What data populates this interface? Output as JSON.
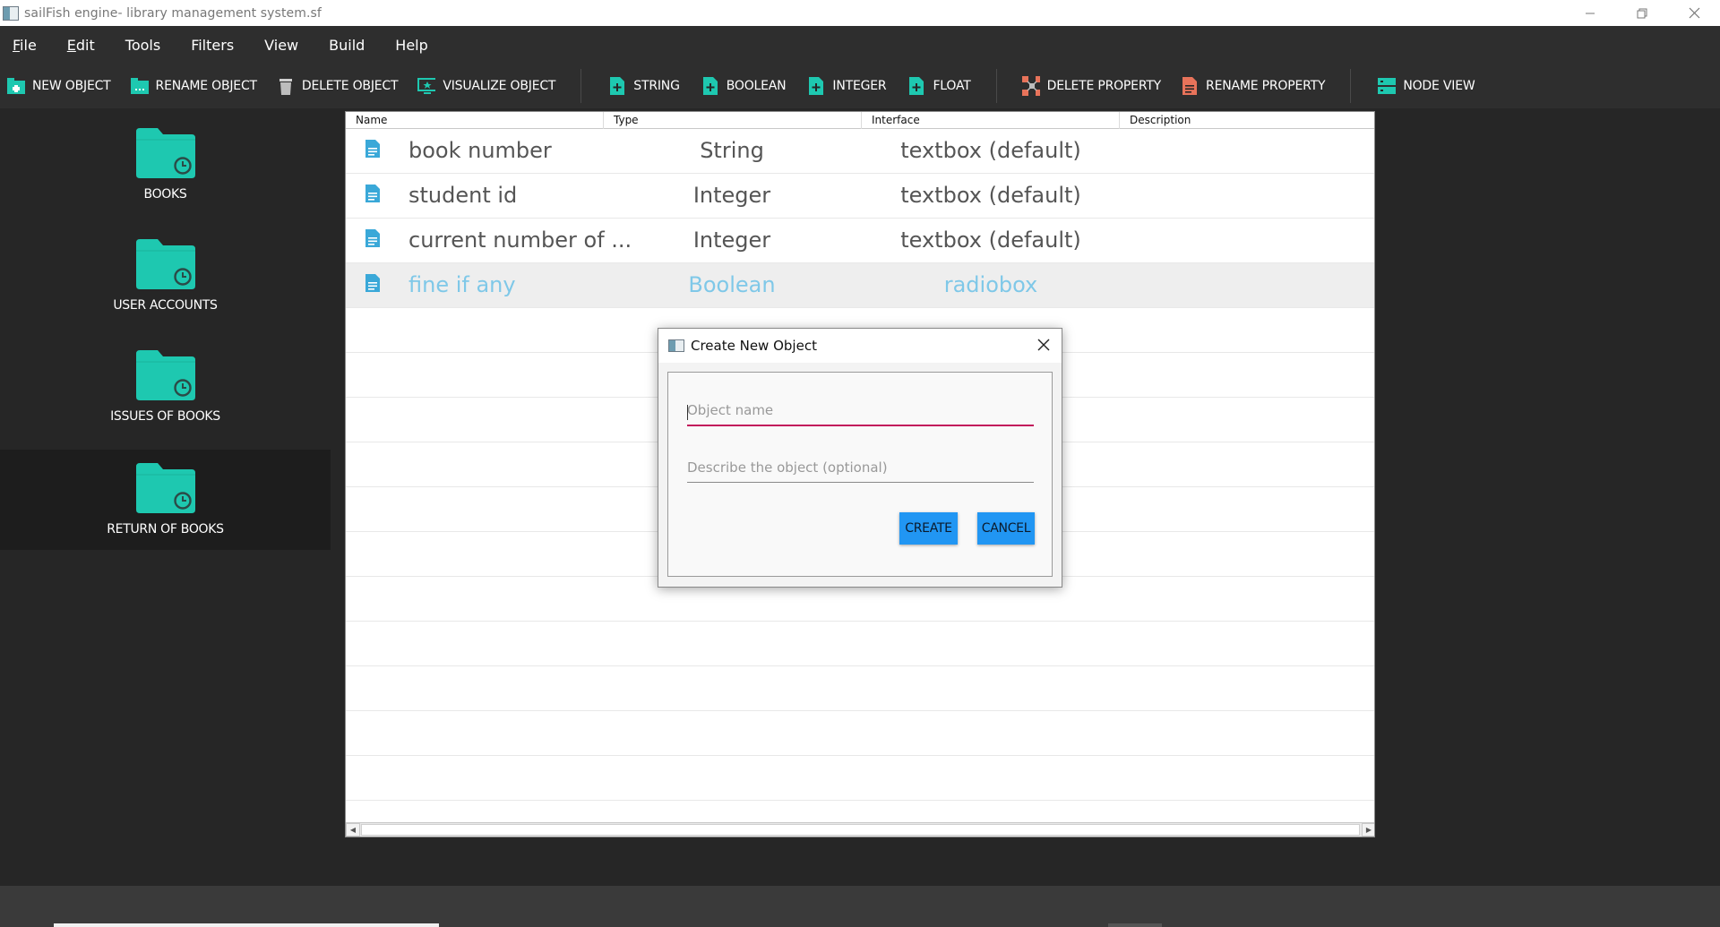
{
  "window": {
    "title": "sailFish engine- library management system.sf",
    "controls": [
      "minimize",
      "restore",
      "close"
    ]
  },
  "menu": [
    {
      "pre": "",
      "mnemonic": "F",
      "post": "ile"
    },
    {
      "pre": "",
      "mnemonic": "E",
      "post": "dit"
    },
    {
      "pre": "Tools",
      "mnemonic": "",
      "post": ""
    },
    {
      "pre": "Filters",
      "mnemonic": "",
      "post": ""
    },
    {
      "pre": "View",
      "mnemonic": "",
      "post": ""
    },
    {
      "pre": "Build",
      "mnemonic": "",
      "post": ""
    },
    {
      "pre": "Help",
      "mnemonic": "",
      "post": ""
    }
  ],
  "toolbar": {
    "new_object": "NEW OBJECT",
    "rename_object": "RENAME OBJECT",
    "delete_object": "DELETE OBJECT",
    "visualize_object": "VISUALIZE OBJECT",
    "string": "STRING",
    "boolean": "BOOLEAN",
    "integer": "INTEGER",
    "float": "FLOAT",
    "delete_property": "DELETE PROPERTY",
    "rename_property": "RENAME PROPERTY",
    "node_view": "NODE VIEW"
  },
  "sidebar": {
    "items": [
      {
        "label": "BOOKS"
      },
      {
        "label": "USER ACCOUNTS"
      },
      {
        "label": "ISSUES OF BOOKS"
      },
      {
        "label": "RETURN OF BOOKS",
        "active": true
      }
    ]
  },
  "table": {
    "columns": [
      "Name",
      "Type",
      "Interface",
      "Description"
    ],
    "rows": [
      {
        "name": "book number",
        "type": "String",
        "interface": "textbox (default)",
        "description": ""
      },
      {
        "name": "student id",
        "type": "Integer",
        "interface": "textbox (default)",
        "description": ""
      },
      {
        "name": "current number of  ...",
        "type": "Integer",
        "interface": "textbox (default)",
        "description": ""
      },
      {
        "name": "fine if any",
        "type": "Boolean",
        "interface": "radiobox",
        "description": "",
        "selected": true
      }
    ]
  },
  "dialog": {
    "title": "Create New Object",
    "name_placeholder": "Object name",
    "name_value": "",
    "desc_placeholder": "Describe the object (optional)",
    "desc_value": "",
    "create_label": "CREATE",
    "cancel_label": "CANCEL"
  },
  "colors": {
    "accent_teal": "#1ec8b0",
    "primary_blue": "#2196f3",
    "focus_pink": "#c2185b",
    "selected_text": "#7fc8e8",
    "doc_icon_blue": "#3aa8d8",
    "rename_property_icon": "#e8735a"
  }
}
